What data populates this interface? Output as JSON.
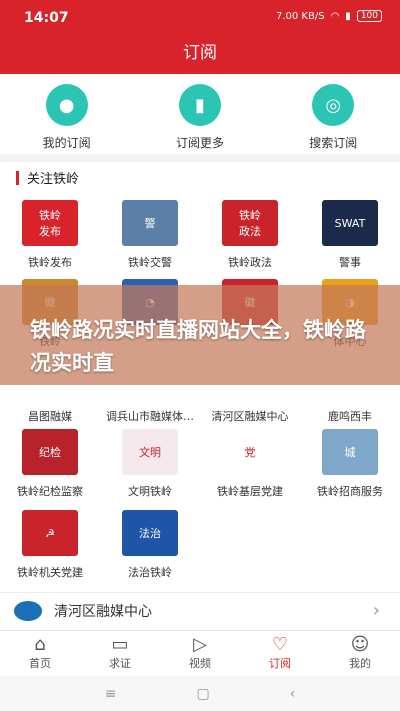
{
  "status": {
    "time": "14:07",
    "net": "7.00 KB/S",
    "battery": "100"
  },
  "header": {
    "title": "订阅"
  },
  "quick": [
    {
      "label": "我的订阅",
      "icon": "user-icon"
    },
    {
      "label": "订阅更多",
      "icon": "bookmark-icon"
    },
    {
      "label": "搜索订阅",
      "icon": "search-icon"
    }
  ],
  "section": {
    "title": "关注铁岭"
  },
  "items": [
    {
      "label": "铁岭发布",
      "color": "#d9232b",
      "glyph": "铁岭\n发布"
    },
    {
      "label": "铁岭交警",
      "color": "#5b7fa6",
      "glyph": "警"
    },
    {
      "label": "铁岭政法",
      "color": "#c9232b",
      "glyph": "铁岭\n政法"
    },
    {
      "label": "警事",
      "color": "#1b2a4a",
      "glyph": "SWAT"
    },
    {
      "label": "铁岭",
      "color": "#c98a2b",
      "glyph": "徽"
    },
    {
      "label": "",
      "color": "#2a62b6",
      "glyph": "◔"
    },
    {
      "label": "",
      "color": "#c9232b",
      "glyph": "徽"
    },
    {
      "label": "体中心",
      "color": "#e9a21a",
      "glyph": "◑"
    },
    {
      "label": "昌图融媒",
      "color": "#fff",
      "glyph": ""
    },
    {
      "label": "调兵山市融媒体…",
      "color": "#fff",
      "glyph": ""
    },
    {
      "label": "清河区融媒中心",
      "color": "#fff",
      "glyph": ""
    },
    {
      "label": "鹿鸣西丰",
      "color": "#fff",
      "glyph": ""
    },
    {
      "label": "铁岭纪检监察",
      "color": "#b8222b",
      "glyph": "纪检"
    },
    {
      "label": "文明铁岭",
      "color": "#f3e8ec",
      "glyph": "文明"
    },
    {
      "label": "铁岭基层党建",
      "color": "#ffffff",
      "glyph": "党"
    },
    {
      "label": "铁岭招商服务",
      "color": "#7fa7c9",
      "glyph": "城"
    },
    {
      "label": "铁岭机关党建",
      "color": "#c9232b",
      "glyph": "☭"
    },
    {
      "label": "法治铁岭",
      "color": "#1f55a6",
      "glyph": "法治"
    }
  ],
  "overlay": {
    "text": "铁岭路况实时直播网站大全，铁岭路况实时直"
  },
  "station": {
    "name": "清河区融媒中心"
  },
  "tabs": [
    {
      "label": "首页",
      "icon": "home-icon",
      "glyph": "⌂"
    },
    {
      "label": "求证",
      "icon": "chat-icon",
      "glyph": "▭"
    },
    {
      "label": "视频",
      "icon": "play-icon",
      "glyph": "▷"
    },
    {
      "label": "订阅",
      "icon": "heart-plus-icon",
      "glyph": "♡"
    },
    {
      "label": "我的",
      "icon": "person-icon",
      "glyph": "☺"
    }
  ],
  "colors": {
    "accent": "#d9232b",
    "teal": "#2cc4b5"
  }
}
